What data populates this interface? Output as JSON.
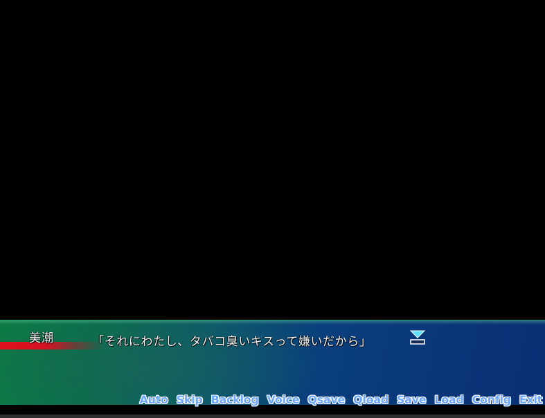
{
  "dialogue": {
    "speaker": "美潮",
    "text": "「それにわたし、タバコ臭いキスって嫌いだから」",
    "accent_color": "#e0101f",
    "indicator_icon": "next-page-arrow-icon"
  },
  "menu": {
    "items": [
      {
        "label": "Auto"
      },
      {
        "label": "Skip"
      },
      {
        "label": "Backlog"
      },
      {
        "label": "Voice"
      },
      {
        "label": "Qsave"
      },
      {
        "label": "Qload"
      },
      {
        "label": "Save"
      },
      {
        "label": "Load"
      },
      {
        "label": "Config"
      },
      {
        "label": "Exit"
      }
    ],
    "text_color": "#6fa8ff"
  },
  "colors": {
    "textbox_green": "#0d7a44",
    "textbox_blue": "#0a2f74"
  }
}
